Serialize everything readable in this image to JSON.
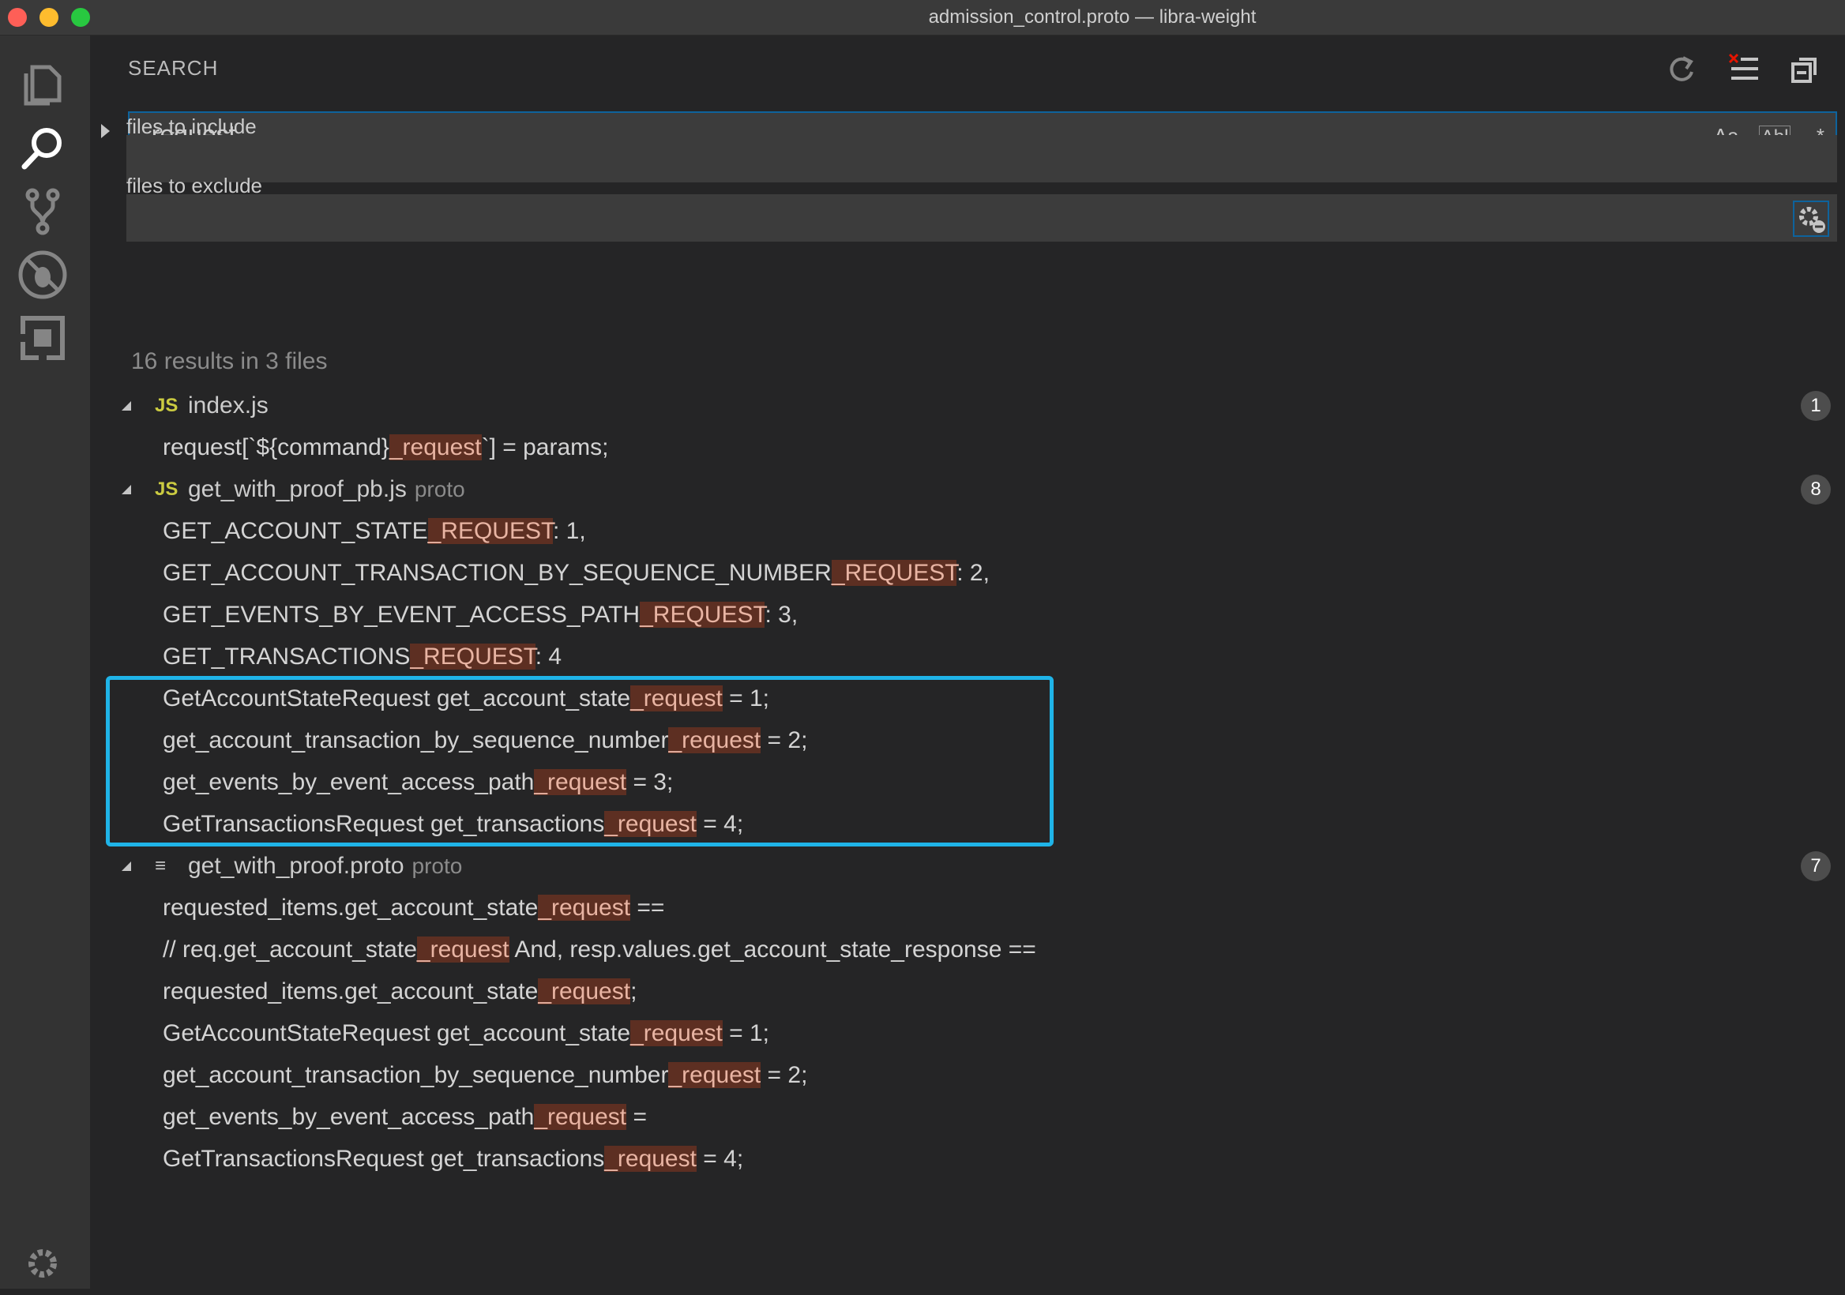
{
  "window": {
    "title": "admission_control.proto — libra-weight"
  },
  "activity_bar": {
    "items": [
      "explorer-icon",
      "search-icon",
      "source-control-icon",
      "debug-icon",
      "extensions-icon",
      "settings-gear-icon"
    ]
  },
  "search": {
    "header": "SEARCH",
    "query": "_request",
    "options": {
      "match_case": "Aa",
      "whole_word": "Abl",
      "regex": ".*"
    },
    "include_label": "files to include",
    "include_value": "",
    "exclude_label": "files to exclude",
    "exclude_value": "",
    "more": "···",
    "summary": "16 results in 3 files"
  },
  "results": [
    {
      "file_type": "JS",
      "file": "index.js",
      "dir": "",
      "count": "1",
      "matches": [
        {
          "before": "request[`${command}",
          "match": "_request",
          "after": "`] = params;"
        }
      ]
    },
    {
      "file_type": "JS",
      "file": "get_with_proof_pb.js",
      "dir": "proto",
      "count": "8",
      "matches": [
        {
          "before": "GET_ACCOUNT_STATE",
          "match": "_REQUEST",
          "after": ": 1,"
        },
        {
          "before": "GET_ACCOUNT_TRANSACTION_BY_SEQUENCE_NUMBER",
          "match": "_REQUEST",
          "after": ": 2,"
        },
        {
          "before": "GET_EVENTS_BY_EVENT_ACCESS_PATH",
          "match": "_REQUEST",
          "after": ": 3,"
        },
        {
          "before": "GET_TRANSACTIONS",
          "match": "_REQUEST",
          "after": ": 4"
        },
        {
          "before": "GetAccountStateRequest get_account_state",
          "match": "_request",
          "after": " = 1;"
        },
        {
          "before": "get_account_transaction_by_sequence_number",
          "match": "_request",
          "after": " = 2;"
        },
        {
          "before": "get_events_by_event_access_path",
          "match": "_request",
          "after": " = 3;"
        },
        {
          "before": "GetTransactionsRequest get_transactions",
          "match": "_request",
          "after": " = 4;"
        }
      ]
    },
    {
      "file_type": "≡",
      "file": "get_with_proof.proto",
      "dir": "proto",
      "count": "7",
      "matches": [
        {
          "before": "requested_items.get_account_state",
          "match": "_request",
          "after": " =="
        },
        {
          "before": "// req.get_account_state",
          "match": "_request",
          "after": " And, resp.values.get_account_state_response =="
        },
        {
          "before": "requested_items.get_account_state",
          "match": "_request",
          "after": ";"
        },
        {
          "before": "GetAccountStateRequest get_account_state",
          "match": "_request",
          "after": " = 1;"
        },
        {
          "before": "get_account_transaction_by_sequence_number",
          "match": "_request",
          "after": " = 2;"
        },
        {
          "before": "get_events_by_event_access_path",
          "match": "_request",
          "after": " ="
        },
        {
          "before": "GetTransactionsRequest get_transactions",
          "match": "_request",
          "after": " = 4;"
        }
      ]
    }
  ],
  "colors": {
    "background": "#252526",
    "activity_bar": "#333333",
    "input_background": "#3c3c3c",
    "focus_border": "#0e639c",
    "match_highlight": "#5d2f22",
    "annotation_box": "#1fb4e8",
    "js_icon": "#cbcb41"
  }
}
